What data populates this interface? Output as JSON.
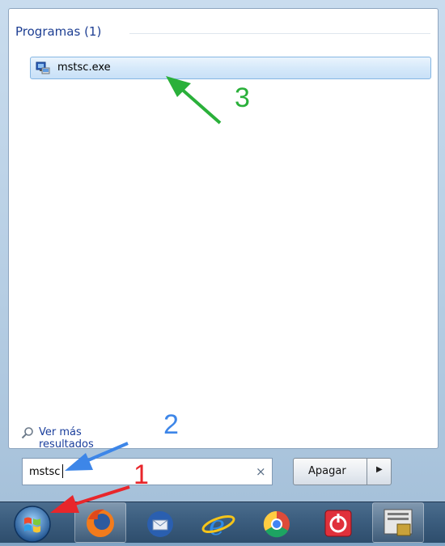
{
  "start_menu": {
    "section_title": "Programas (1)",
    "result_item": {
      "label": "mstsc.exe",
      "icon": "remote-desktop-icon"
    },
    "more_results": {
      "label": "Ver más resultados",
      "icon": "search-icon"
    },
    "search": {
      "value": "mstsc",
      "clear_glyph": "×"
    },
    "shutdown": {
      "label": "Apagar",
      "arrow_glyph": "▶"
    }
  },
  "taskbar": {
    "items": [
      "start-orb-icon",
      "firefox-icon",
      "thunderbird-icon",
      "internet-explorer-icon",
      "chrome-icon",
      "power-app-icon",
      "document-app-icon"
    ]
  },
  "annotations": {
    "step1": {
      "text": "1",
      "color": "#e8262b"
    },
    "step2": {
      "text": "2",
      "color": "#3d86e8"
    },
    "step3": {
      "text": "3",
      "color": "#2ab03a"
    }
  }
}
